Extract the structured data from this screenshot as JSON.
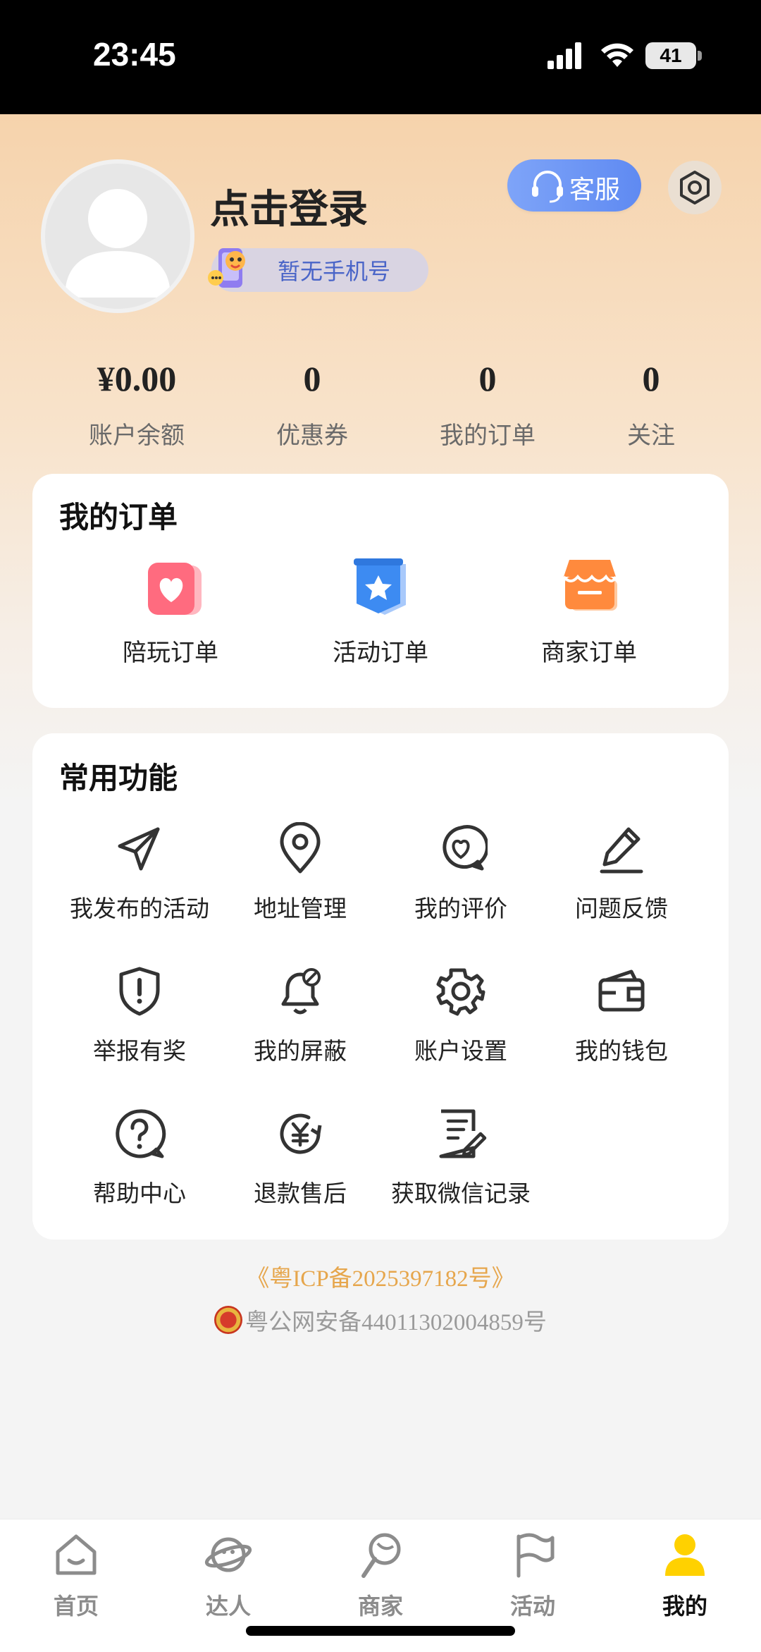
{
  "status_bar": {
    "time": "23:45",
    "battery": "41"
  },
  "profile": {
    "login_title": "点击登录",
    "phone_badge": "暂无手机号",
    "service_label": "客服"
  },
  "stats": [
    {
      "value": "¥0.00",
      "label": "账户余额"
    },
    {
      "value": "0",
      "label": "优惠券"
    },
    {
      "value": "0",
      "label": "我的订单"
    },
    {
      "value": "0",
      "label": "关注"
    }
  ],
  "orders": {
    "title": "我的订单",
    "items": [
      {
        "label": "陪玩订单",
        "icon": "heart-card-icon",
        "color": "#ff6b7f"
      },
      {
        "label": "活动订单",
        "icon": "star-badge-icon",
        "color": "#3d8bf2"
      },
      {
        "label": "商家订单",
        "icon": "store-icon",
        "color": "#ff8a3d"
      }
    ]
  },
  "functions": {
    "title": "常用功能",
    "items": [
      {
        "label": "我发布的活动",
        "icon": "send-icon"
      },
      {
        "label": "地址管理",
        "icon": "location-icon"
      },
      {
        "label": "我的评价",
        "icon": "heart-chat-icon"
      },
      {
        "label": "问题反馈",
        "icon": "pen-icon"
      },
      {
        "label": "举报有奖",
        "icon": "shield-alert-icon"
      },
      {
        "label": "我的屏蔽",
        "icon": "bell-off-icon"
      },
      {
        "label": "账户设置",
        "icon": "gear-icon"
      },
      {
        "label": "我的钱包",
        "icon": "wallet-icon"
      },
      {
        "label": "帮助中心",
        "icon": "question-chat-icon"
      },
      {
        "label": "退款售后",
        "icon": "refund-icon"
      },
      {
        "label": "获取微信记录",
        "icon": "document-edit-icon"
      }
    ]
  },
  "footer": {
    "icp": "《粤ICP备2025397182号》",
    "police": "粤公网安备44011302004859号"
  },
  "tabbar": {
    "items": [
      {
        "label": "首页",
        "icon": "home-icon"
      },
      {
        "label": "达人",
        "icon": "planet-icon"
      },
      {
        "label": "商家",
        "icon": "lollipop-icon"
      },
      {
        "label": "活动",
        "icon": "flag-icon"
      },
      {
        "label": "我的",
        "icon": "person-icon"
      }
    ],
    "active_index": 4,
    "active_color": "#ffd100"
  }
}
